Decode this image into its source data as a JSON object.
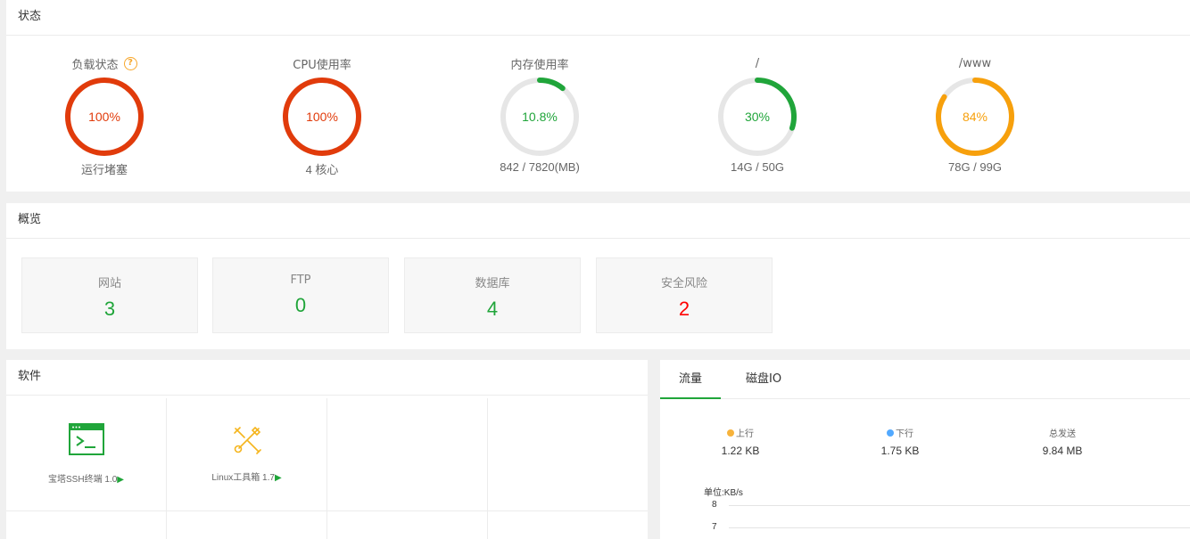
{
  "status": {
    "title": "状态",
    "gauges": [
      {
        "label": "负载状态",
        "value": "100%",
        "percent": 100,
        "sub": "运行堵塞",
        "color": "#e13b0b",
        "help": true
      },
      {
        "label": "CPU使用率",
        "value": "100%",
        "percent": 100,
        "sub": "4 核心",
        "color": "#e13b0b"
      },
      {
        "label": "内存使用率",
        "value": "10.8%",
        "percent": 10.8,
        "sub": "842 / 7820(MB)",
        "color": "#20a53a"
      },
      {
        "label": "/",
        "value": "30%",
        "percent": 30,
        "sub": "14G / 50G",
        "color": "#20a53a"
      },
      {
        "label": "/www",
        "value": "84%",
        "percent": 84,
        "sub": "78G / 99G",
        "color": "#f7a00c"
      }
    ],
    "help_glyph": "?"
  },
  "overview": {
    "title": "概览",
    "cards": [
      {
        "label": "网站",
        "value": "3",
        "color": "#20a53a"
      },
      {
        "label": "FTP",
        "value": "0",
        "color": "#20a53a"
      },
      {
        "label": "数据库",
        "value": "4",
        "color": "#20a53a"
      },
      {
        "label": "安全风险",
        "value": "2",
        "color": "#ff0000"
      }
    ]
  },
  "software": {
    "title": "软件",
    "items": [
      {
        "name": "宝塔SSH终端 1.0",
        "icon": "terminal-icon"
      },
      {
        "name": "Linux工具箱 1.7",
        "icon": "tools-icon"
      }
    ],
    "arrow": "▶"
  },
  "traffic": {
    "tabs": [
      {
        "label": "流量",
        "active": true
      },
      {
        "label": "磁盘IO",
        "active": false
      }
    ],
    "stats": [
      {
        "label": "上行",
        "value": "1.22 KB",
        "dot_color": "#f7b33c"
      },
      {
        "label": "下行",
        "value": "1.75 KB",
        "dot_color": "#52a9ff"
      },
      {
        "label": "总发送",
        "value": "9.84 MB"
      }
    ],
    "unit": "单位:KB/s",
    "y_ticks": [
      "8",
      "7"
    ]
  }
}
